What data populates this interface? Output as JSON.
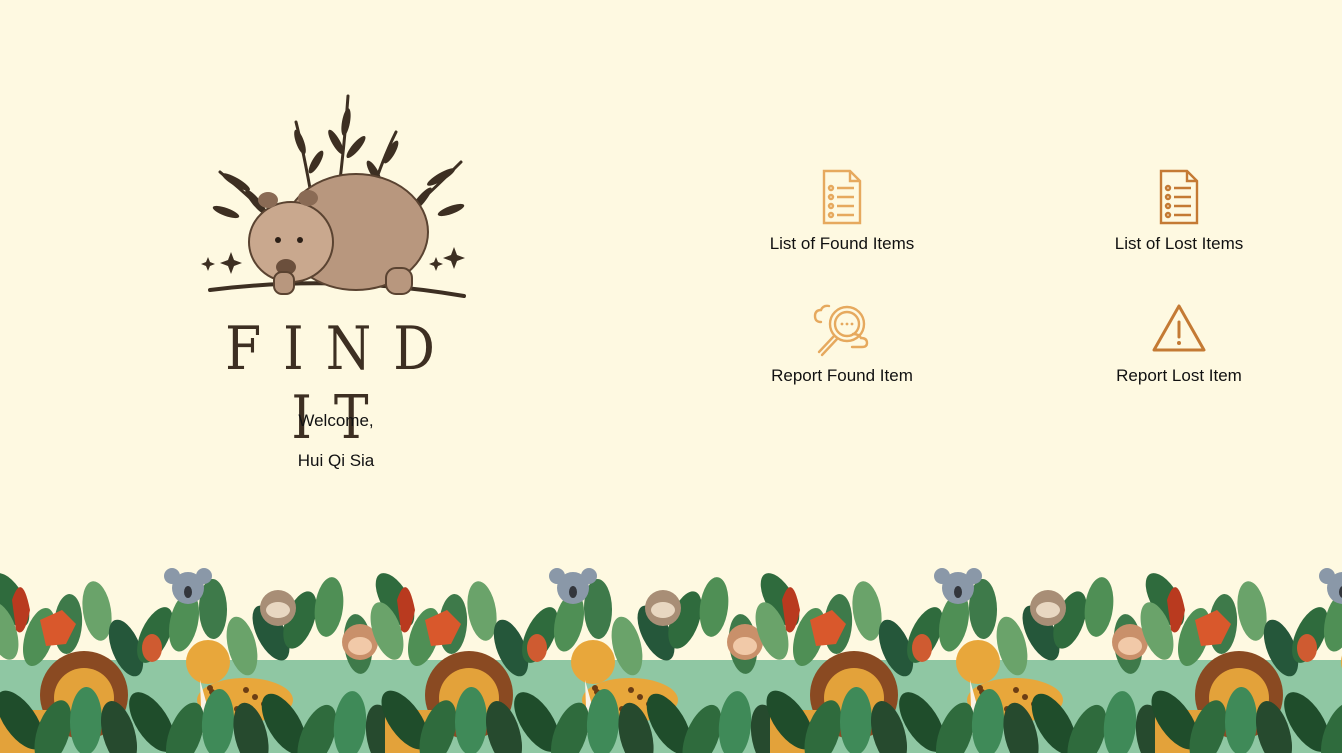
{
  "brand": {
    "wordmark": "FIND IT",
    "logo_icon": "wombat-logo-icon"
  },
  "welcome": {
    "greeting": "Welcome,",
    "user_name": "Hui Qi Sia"
  },
  "menu": [
    {
      "label": "List of Found Items",
      "icon": "list-document-icon",
      "color": "#e6a95e"
    },
    {
      "label": "List of Lost Items",
      "icon": "list-document-icon",
      "color": "#c47a34"
    },
    {
      "label": "Report Found Item",
      "icon": "magnifier-chat-icon",
      "color": "#e6a95e"
    },
    {
      "label": "Report Lost Item",
      "icon": "warning-triangle-icon",
      "color": "#c47a34"
    }
  ],
  "colors": {
    "background": "#fef9e1",
    "brand_brown": "#3d2f22",
    "leaf_green": "#3e7a4a",
    "mint": "#8fc7a3"
  }
}
